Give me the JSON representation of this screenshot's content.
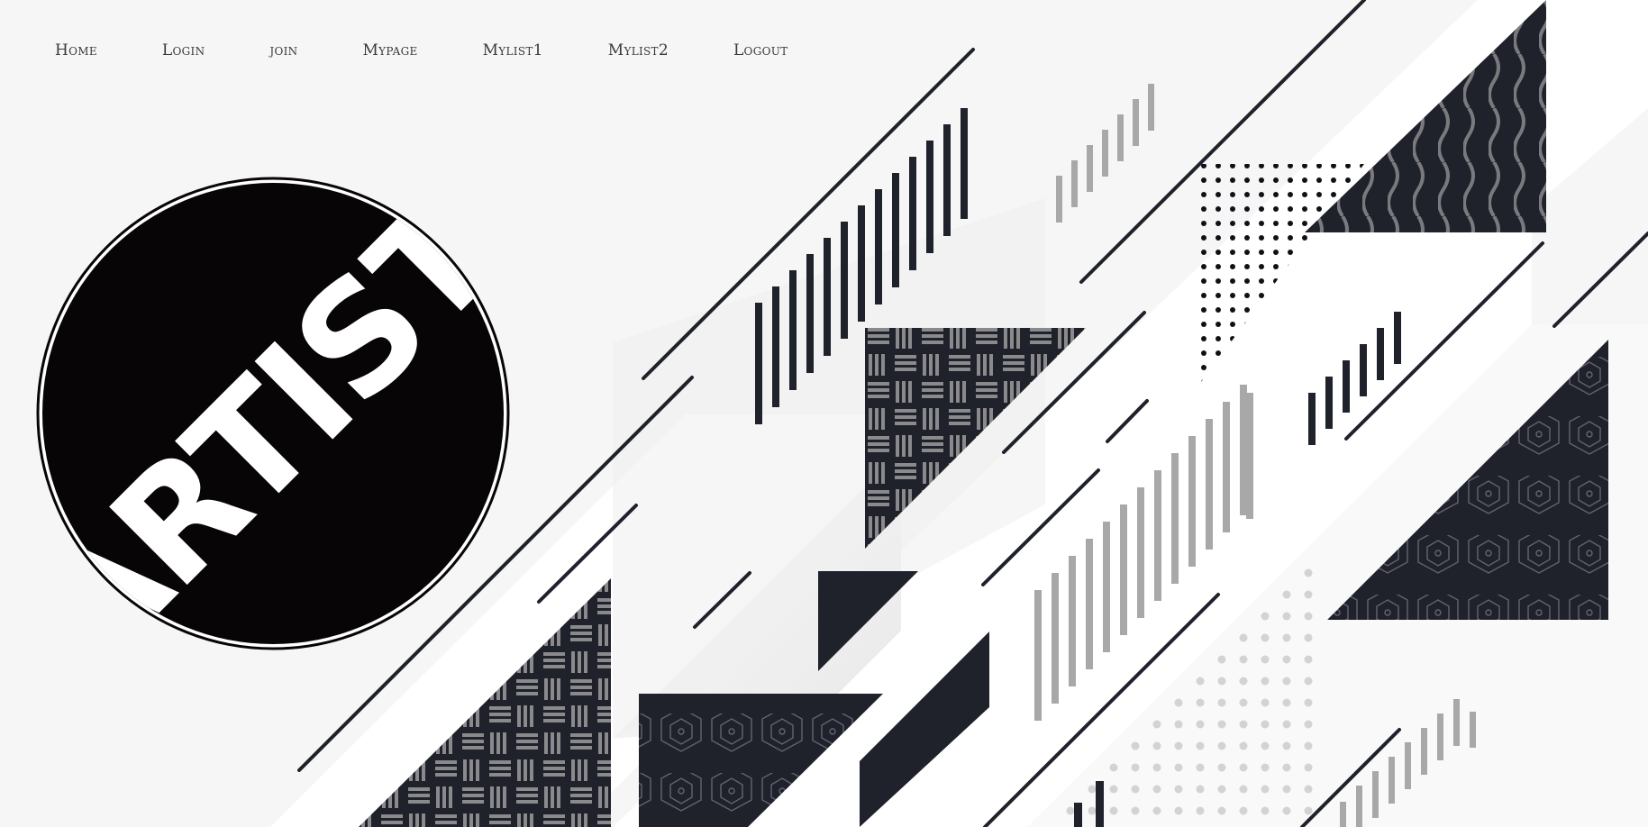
{
  "nav": {
    "items": [
      {
        "key": "home",
        "label": "Home"
      },
      {
        "key": "login",
        "label": "Login"
      },
      {
        "key": "join",
        "label": "join"
      },
      {
        "key": "mypage",
        "label": "Mypage"
      },
      {
        "key": "mylist1",
        "label": "Mylist1"
      },
      {
        "key": "mylist2",
        "label": "Mylist2"
      },
      {
        "key": "logout",
        "label": "Logout"
      }
    ]
  },
  "logo": {
    "text": "ARTIST"
  },
  "colors": {
    "background": "#f6f6f6",
    "navy": "#1f212b",
    "pattern_gray": "#8a8a8c",
    "stripe_gray": "#a8a8a8",
    "white": "#ffffff",
    "logo_black": "#070506"
  }
}
